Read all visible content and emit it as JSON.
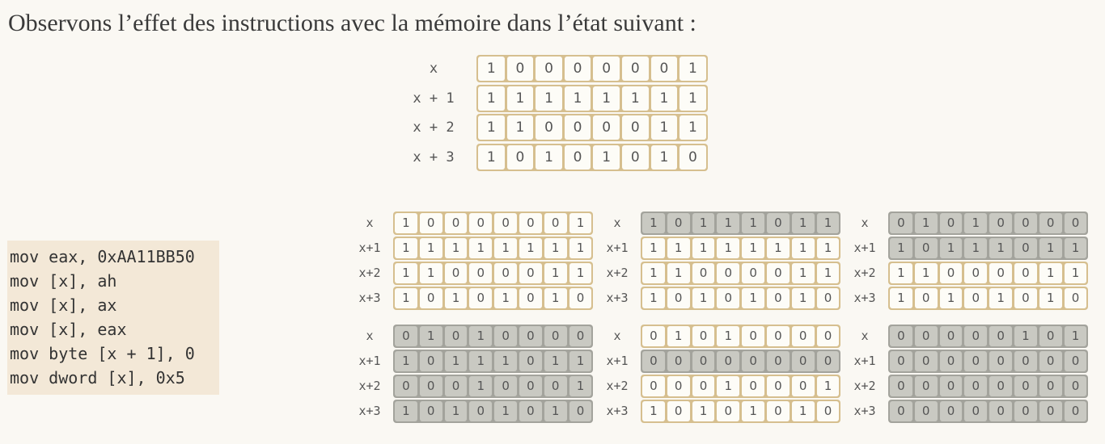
{
  "title": "Observons l’effet des instructions avec la mémoire dans l’état suivant :",
  "initial_memory": {
    "rows": [
      {
        "label": "x",
        "bits": "10000001"
      },
      {
        "label": "x + 1",
        "bits": "11111111"
      },
      {
        "label": "x + 2",
        "bits": "11000011"
      },
      {
        "label": "x + 3",
        "bits": "10101010"
      }
    ]
  },
  "code": [
    "mov eax, 0xAA11BB50",
    "mov [x], ah",
    "mov [x], ax",
    "mov [x], eax",
    "mov byte [x + 1], 0",
    "mov dword [x], 0x5"
  ],
  "states": [
    {
      "rows": [
        {
          "label": "x",
          "bits": "10000001",
          "highlight": false
        },
        {
          "label": "x+1",
          "bits": "11111111",
          "highlight": false
        },
        {
          "label": "x+2",
          "bits": "11000011",
          "highlight": false
        },
        {
          "label": "x+3",
          "bits": "10101010",
          "highlight": false
        }
      ]
    },
    {
      "rows": [
        {
          "label": "x",
          "bits": "10111011",
          "highlight": true
        },
        {
          "label": "x+1",
          "bits": "11111111",
          "highlight": false
        },
        {
          "label": "x+2",
          "bits": "11000011",
          "highlight": false
        },
        {
          "label": "x+3",
          "bits": "10101010",
          "highlight": false
        }
      ]
    },
    {
      "rows": [
        {
          "label": "x",
          "bits": "01010000",
          "highlight": true
        },
        {
          "label": "x+1",
          "bits": "10111011",
          "highlight": true
        },
        {
          "label": "x+2",
          "bits": "11000011",
          "highlight": false
        },
        {
          "label": "x+3",
          "bits": "10101010",
          "highlight": false
        }
      ]
    },
    {
      "rows": [
        {
          "label": "x",
          "bits": "01010000",
          "highlight": true
        },
        {
          "label": "x+1",
          "bits": "10111011",
          "highlight": true
        },
        {
          "label": "x+2",
          "bits": "00010001",
          "highlight": true
        },
        {
          "label": "x+3",
          "bits": "10101010",
          "highlight": true
        }
      ]
    },
    {
      "rows": [
        {
          "label": "x",
          "bits": "01010000",
          "highlight": false
        },
        {
          "label": "x+1",
          "bits": "00000000",
          "highlight": true
        },
        {
          "label": "x+2",
          "bits": "00010001",
          "highlight": false
        },
        {
          "label": "x+3",
          "bits": "10101010",
          "highlight": false
        }
      ]
    },
    {
      "rows": [
        {
          "label": "x",
          "bits": "00000101",
          "highlight": true
        },
        {
          "label": "x+1",
          "bits": "00000000",
          "highlight": true
        },
        {
          "label": "x+2",
          "bits": "00000000",
          "highlight": true
        },
        {
          "label": "x+3",
          "bits": "00000000",
          "highlight": true
        }
      ]
    }
  ]
}
